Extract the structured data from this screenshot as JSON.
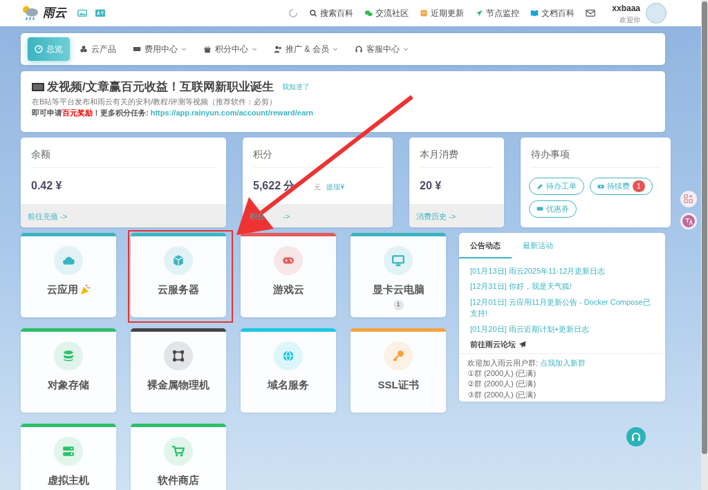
{
  "header": {
    "brand": "雨云",
    "links": [
      {
        "label": "搜索百科"
      },
      {
        "label": "交流社区"
      },
      {
        "label": "近期更新"
      },
      {
        "label": "节点监控"
      },
      {
        "label": "文档百科"
      }
    ],
    "user": {
      "name": "xxbaaa",
      "greeting": "欢迎你"
    }
  },
  "nav": [
    {
      "label": "总览",
      "selected": true,
      "dropdown": false
    },
    {
      "label": "云产品",
      "selected": false,
      "dropdown": false
    },
    {
      "label": "费用中心",
      "selected": false,
      "dropdown": true
    },
    {
      "label": "积分中心",
      "selected": false,
      "dropdown": true
    },
    {
      "label": "推广 & 会员",
      "selected": false,
      "dropdown": true
    },
    {
      "label": "客服中心",
      "selected": false,
      "dropdown": true
    }
  ],
  "notice": {
    "title": "发视频/文章赢百元收益！互联网新职业诞生",
    "dismiss": "我知道了",
    "line1": "在B站等平台发布和雨云有关的安利/教程/评测等视频（推荐软件：必剪）",
    "line2": "即可申请**百元奖励**！更多积分任务: ",
    "link": "https://app.rainyun.com/account/reward/earn"
  },
  "stats": [
    {
      "title": "余额",
      "value": "0.42 ¥",
      "footer": "前往充值 ->"
    },
    {
      "title": "积分",
      "value": "5,622 分",
      "note": "元",
      "action": "提现¥",
      "footer": "积分",
      "footer_tail": "->"
    },
    {
      "title": "本月消费",
      "value": "20 ¥",
      "footer": "消费历史 ->"
    }
  ],
  "todo": {
    "title": "待办事项",
    "buttons": [
      {
        "label": "待办工单"
      },
      {
        "label": "待续费",
        "badge": "1"
      },
      {
        "label": "优惠券"
      }
    ]
  },
  "products": [
    {
      "label": "云应用",
      "color": "#3bb4c1"
    },
    {
      "label": "云服务器",
      "color": "#3bb4c1"
    },
    {
      "label": "游戏云",
      "color": "#e45a5a"
    },
    {
      "label": "显卡云电脑",
      "color": "#3bb4c1",
      "badge": "1"
    },
    {
      "label": "对象存储",
      "color": "#2ebf6b"
    },
    {
      "label": "裸金属物理机",
      "color": "#444444"
    },
    {
      "label": "域名服务",
      "color": "#1ac8e0"
    },
    {
      "label": "SSL证书",
      "color": "#f7a23b"
    },
    {
      "label": "虚拟主机",
      "color": "#2ebf6b"
    },
    {
      "label": "软件商店",
      "color": "#2ebf6b"
    }
  ],
  "news": {
    "tabs": [
      {
        "label": "公告动态",
        "selected": true
      },
      {
        "label": "最新活动",
        "selected": false
      }
    ],
    "items": [
      "[01月13日] 雨云2025年11-12月更新日志",
      "[12月31日] 你好，我是天气狐!",
      "[12月01日] 云应用11月更新公告 - Docker Compose已支持!",
      "[01月20日] 雨云近期计划+更新日志"
    ],
    "forum": "前往雨云论坛",
    "group_intro": "欢迎加入雨云用户群: ",
    "group_link": "点我加入新群",
    "groups": [
      "①群 (2000人) (已满)",
      "②群 (2000人) (已满)",
      "③群 (2000人) (已满)"
    ]
  }
}
